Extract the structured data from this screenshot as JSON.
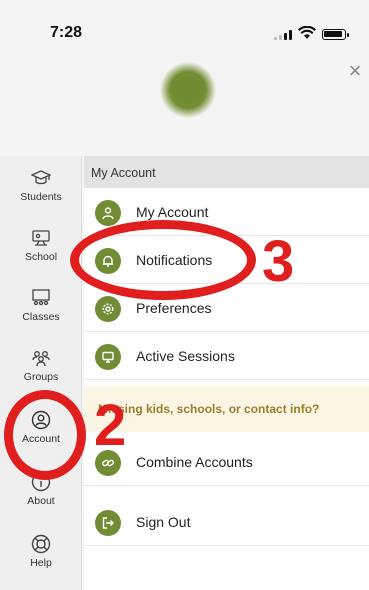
{
  "status_bar": {
    "time": "7:28"
  },
  "header": {
    "close_glyph": "×"
  },
  "sidebar": {
    "items": [
      {
        "label": "Students",
        "icon": "graduation-cap-icon"
      },
      {
        "label": "School",
        "icon": "school-icon"
      },
      {
        "label": "Classes",
        "icon": "classroom-icon"
      },
      {
        "label": "Groups",
        "icon": "groups-icon"
      },
      {
        "label": "Account",
        "icon": "account-icon",
        "selected": true
      },
      {
        "label": "About",
        "icon": "info-icon"
      },
      {
        "label": "Help",
        "icon": "lifebuoy-icon"
      }
    ]
  },
  "main": {
    "section_title": "My Account",
    "items": [
      {
        "label": "My Account",
        "icon": "user-icon"
      },
      {
        "label": "Notifications",
        "icon": "bell-icon"
      },
      {
        "label": "Preferences",
        "icon": "gear-icon"
      },
      {
        "label": "Active Sessions",
        "icon": "monitor-icon"
      }
    ],
    "banner": "Missing kids, schools, or contact info?",
    "items_after": [
      {
        "label": "Combine Accounts",
        "icon": "link-icon"
      },
      {
        "label": "Sign Out",
        "icon": "sign-out-icon"
      }
    ]
  },
  "annotations": {
    "step_2": "2",
    "step_3": "3"
  },
  "colors": {
    "accent": "#718c34",
    "annotation": "#e01e1e",
    "banner_bg": "#fbf6e4",
    "banner_text": "#9a7d2e"
  }
}
